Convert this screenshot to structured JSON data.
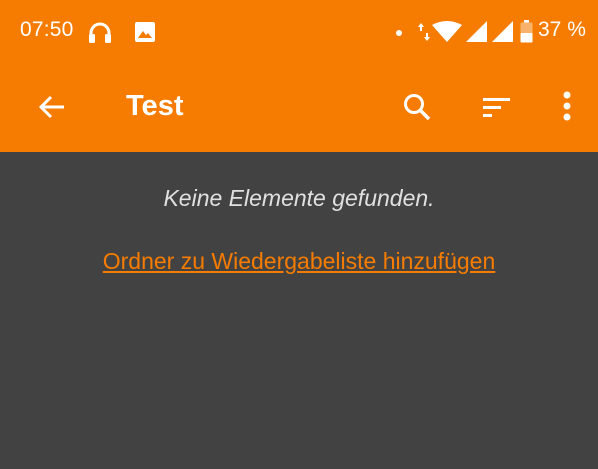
{
  "status_bar": {
    "time": "07:50",
    "battery_percent": "37 %",
    "icons": [
      "headphones-icon",
      "image-icon",
      "dot-icon",
      "data-arrows-icon",
      "wifi-icon",
      "signal-icon",
      "signal-icon",
      "battery-icon"
    ]
  },
  "app_bar": {
    "title": "Test",
    "icons": [
      "back-arrow-icon",
      "search-icon",
      "sort-icon",
      "more-vert-icon"
    ]
  },
  "content": {
    "empty_message": "Keine Elemente gefunden.",
    "add_folder_link": "Ordner zu Wiedergabeliste hinzufügen"
  },
  "colors": {
    "accent": "#F57C00",
    "background": "#424242",
    "text": "#E0E0E0"
  }
}
